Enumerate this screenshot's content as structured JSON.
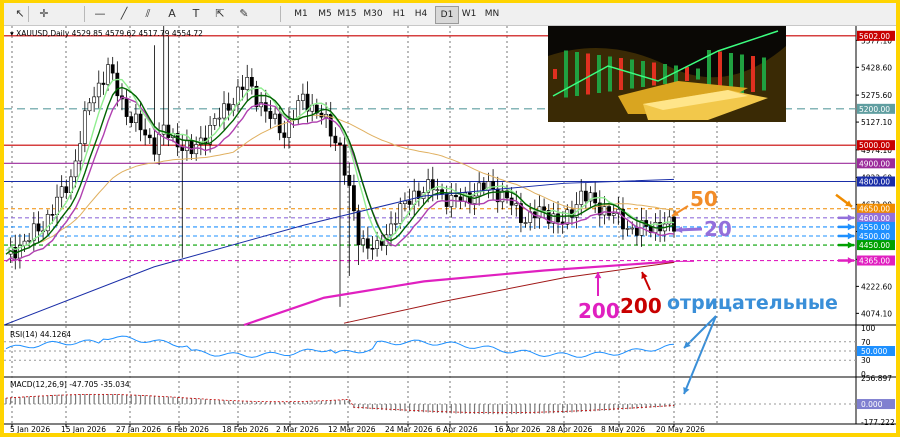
{
  "toolbar": {
    "icons": [
      "cursor-icon",
      "crosshair-icon",
      "horizontal-line-icon",
      "trend-line-icon",
      "channel-icon",
      "text-icon",
      "label-icon",
      "arrow-icon",
      "shapes-icon"
    ],
    "timeframes": [
      "M1",
      "M5",
      "M15",
      "M30",
      "H1",
      "H4",
      "D1",
      "W1",
      "MN"
    ],
    "active_timeframe": "D1"
  },
  "chart": {
    "symbol_line": "XAUUSD,Daily  4529.85 4579.62 4517.79 4554.72",
    "price_ticks": [
      "5577.10",
      "5428.60",
      "5275.60",
      "5127.10",
      "4974.10",
      "4822.60",
      "4673.00",
      "4524.60",
      "4371.60",
      "4222.60",
      "4074.10"
    ],
    "level_labels": [
      {
        "text": "5602.00",
        "color": "#c80000"
      },
      {
        "text": "5200.00",
        "color": "#5f9ea0"
      },
      {
        "text": "5000.00",
        "color": "#c80000"
      },
      {
        "text": "4900.00",
        "color": "#9b2b9b"
      },
      {
        "text": "4800.00",
        "color": "#1a2ea8"
      },
      {
        "text": "4650.00",
        "color": "#f08c00"
      },
      {
        "text": "4600.00",
        "color": "#9370db"
      },
      {
        "text": "4550.00",
        "color": "#1e90ff"
      },
      {
        "text": "4500.00",
        "color": "#1e90ff"
      },
      {
        "text": "4450.00",
        "color": "#00a000"
      },
      {
        "text": "4365.00",
        "color": "#e020c0"
      }
    ],
    "date_labels": [
      "5 Jan 2026",
      "15 Jan 2026",
      "27 Jan 2026",
      "6 Feb 2026",
      "18 Feb 2026",
      "2 Mar 2026",
      "12 Mar 2026",
      "24 Mar 2026",
      "6 Apr 2026",
      "16 Apr 2026",
      "28 Apr 2026",
      "8 May 2026",
      "20 May 2026"
    ],
    "annotations": {
      "ma50": "50",
      "ma20": "20",
      "ma200_pink": "200",
      "ma200_red": "200",
      "negative": "отрицательные"
    },
    "rsi": {
      "title": "RSI(14) 44.1264",
      "ticks": [
        "100",
        "70",
        "50.000",
        "30",
        "0"
      ]
    },
    "macd": {
      "title": "MACD(12,26,9) -47.705 -35.034",
      "ticks": [
        "256.897",
        "0.000",
        "-177.222"
      ]
    },
    "image_alt": "gold-bars-image"
  },
  "colors": {
    "frame": "#ffd400",
    "bull": "#ffffff",
    "bear": "#000000",
    "ma_fast": "#006400",
    "ma_light": "#90ee90",
    "ma_purple": "#b040b0",
    "ma50": "#e0b060",
    "ma200_blue": "#1a2ea8",
    "ma200_pink": "#e020c0",
    "ma200_red": "#a01818"
  }
}
